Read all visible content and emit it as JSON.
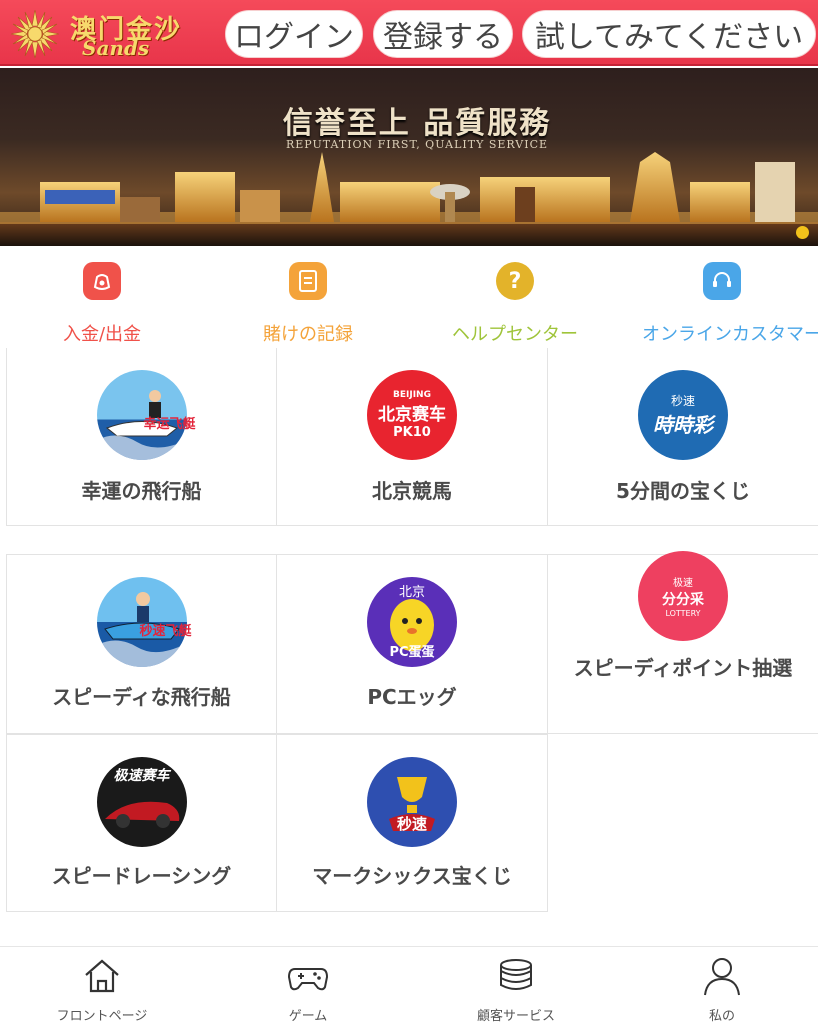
{
  "header": {
    "logo_cn": "澳门金沙",
    "logo_en": "Sands",
    "login_label": "ログイン",
    "register_label": "登録する",
    "trial_label": "試してみてください"
  },
  "banner": {
    "title": "信誉至上 品質服務",
    "subtitle": "REPUTATION FIRST, QUALITY SERVICE",
    "indicator_color": "#f2c21b"
  },
  "quick_menu": [
    {
      "label": "入金/出金",
      "icon": "wallet-bag-icon",
      "color": "#f0524a"
    },
    {
      "label": "賭けの記録",
      "icon": "document-icon",
      "color": "#f4a33a"
    },
    {
      "label": "ヘルプセンター",
      "icon": "question-icon",
      "color": "#e3b32a"
    },
    {
      "label": "オンラインカスタマー",
      "icon": "headset-icon",
      "color": "#4aa6e8"
    }
  ],
  "games": [
    {
      "name": "幸運の飛行船",
      "icon": "lucky-boat-icon",
      "icon_text": "幸运飞艇"
    },
    {
      "name": "北京競馬",
      "icon": "beijing-racing-icon",
      "icon_text": "北京赛车",
      "icon_sub": "PK10",
      "icon_top": "BEIJING"
    },
    {
      "name": "5分間の宝くじ",
      "icon": "time-lottery-icon",
      "icon_text": "時時彩",
      "icon_top": "秒速"
    },
    {
      "name": "スピーディな飛行船",
      "icon": "speedy-boat-icon",
      "icon_text": "秒速飞艇"
    },
    {
      "name": "PCエッグ",
      "icon": "pc-egg-icon",
      "icon_text": "PC蛋蛋",
      "icon_top": "北京"
    },
    {
      "name": "スピーディポイント抽選",
      "icon": "fast-points-icon",
      "icon_text": "分分采",
      "icon_top": "极速",
      "icon_sub": "LOTTERY"
    },
    {
      "name": "スピードレーシング",
      "icon": "speed-racing-icon",
      "icon_text": "极速赛车"
    },
    {
      "name": "マークシックス宝くじ",
      "icon": "mark-six-icon",
      "icon_text": "秒速"
    }
  ],
  "bottom_nav": [
    {
      "label": "フロントページ",
      "icon": "home-icon"
    },
    {
      "label": "ゲーム",
      "icon": "gamepad-icon"
    },
    {
      "label": "顧客サービス",
      "icon": "coins-stack-icon"
    },
    {
      "label": "私の",
      "icon": "user-icon"
    }
  ]
}
